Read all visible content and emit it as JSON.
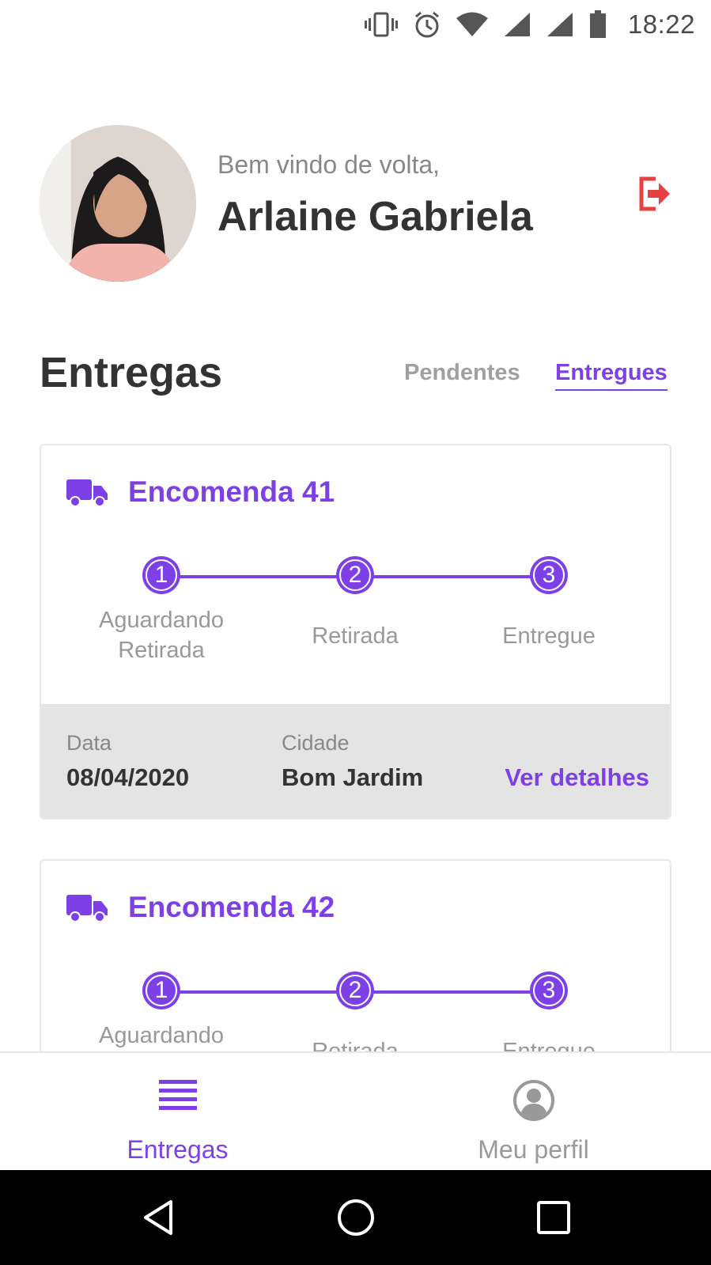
{
  "status_bar": {
    "time": "18:22"
  },
  "header": {
    "welcome": "Bem vindo de volta,",
    "username": "Arlaine Gabriela"
  },
  "section": {
    "title": "Entregas",
    "tabs": [
      {
        "label": "Pendentes",
        "active": false
      },
      {
        "label": "Entregues",
        "active": true
      }
    ]
  },
  "deliveries": [
    {
      "title": "Encomenda 41",
      "steps": [
        {
          "number": "1",
          "label": "Aguardando Retirada"
        },
        {
          "number": "2",
          "label": "Retirada"
        },
        {
          "number": "3",
          "label": "Entregue"
        }
      ],
      "date_label": "Data",
      "date": "08/04/2020",
      "city_label": "Cidade",
      "city": "Bom Jardim",
      "details_label": "Ver detalhes"
    },
    {
      "title": "Encomenda 42",
      "steps": [
        {
          "number": "1",
          "label": "Aguardando"
        },
        {
          "number": "2",
          "label": "Retirada"
        },
        {
          "number": "3",
          "label": "Entregue"
        }
      ]
    }
  ],
  "bottom_nav": {
    "items": [
      {
        "label": "Entregas",
        "icon": "list-icon",
        "active": true
      },
      {
        "label": "Meu perfil",
        "icon": "user-circle-icon",
        "active": false
      }
    ]
  },
  "colors": {
    "accent": "#7d40e7",
    "logout": "#e74040",
    "footer_bg": "#e4e4e4"
  }
}
